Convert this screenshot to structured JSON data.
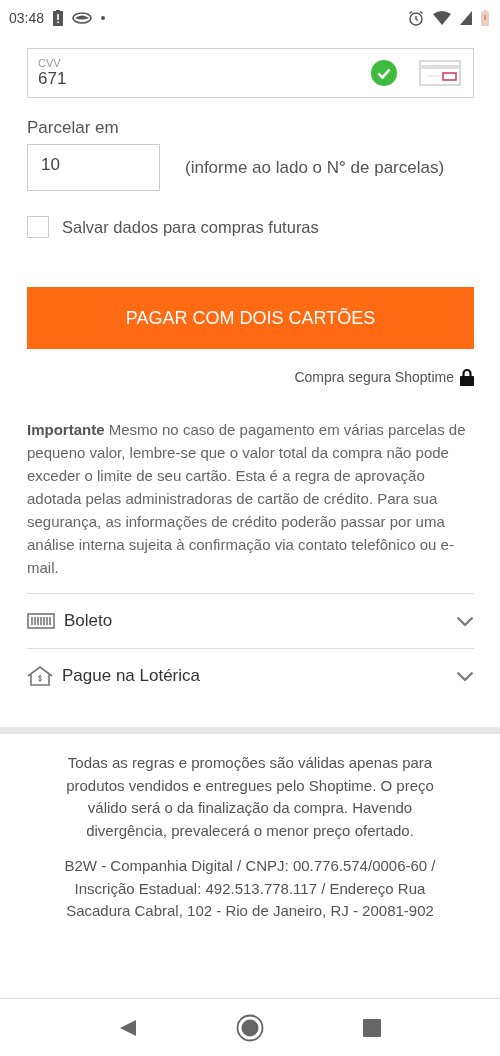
{
  "status_bar": {
    "time": "03:48"
  },
  "cvv": {
    "label": "CVV",
    "value": "671",
    "valid": true
  },
  "installments": {
    "label": "Parcelar em",
    "value": "10",
    "hint": "(informe ao lado o N° de parcelas)"
  },
  "save_data": {
    "label": "Salvar dados para compras futuras",
    "checked": false
  },
  "pay_button": "PAGAR COM DOIS CARTÕES",
  "secure_note": "Compra segura Shoptime",
  "notice": "**Importante** Mesmo no caso de pagamento em várias parcelas de pequeno valor, lembre-se que o valor total da compra não pode exceder o limite de seu cartão. Esta é a regra de aprovação adotada pelas administradoras de cartão de crédito. Para sua segurança, as informações de crédito poderão passar por uma análise interna sujeita à confirmação via contato telefônico ou e-mail.",
  "payment_options": [
    {
      "kind": "barcode",
      "label": "Boleto",
      "expanded": false
    },
    {
      "kind": "house",
      "label": "Pague na Lotérica",
      "expanded": false
    }
  ],
  "footer": [
    "Todas as regras e promoções são válidas apenas para produtos vendidos e entregues pelo Shoptime. O preço válido será o da finalização da compra. Havendo divergência, prevalecerá o menor preço ofertado.",
    "B2W - Companhia Digital / CNPJ: 00.776.574/0006-60 / Inscrição Estadual: 492.513.778.117 / Endereço Rua Sacadura Cabral, 102 - Rio de Janeiro, RJ - 20081-902"
  ]
}
